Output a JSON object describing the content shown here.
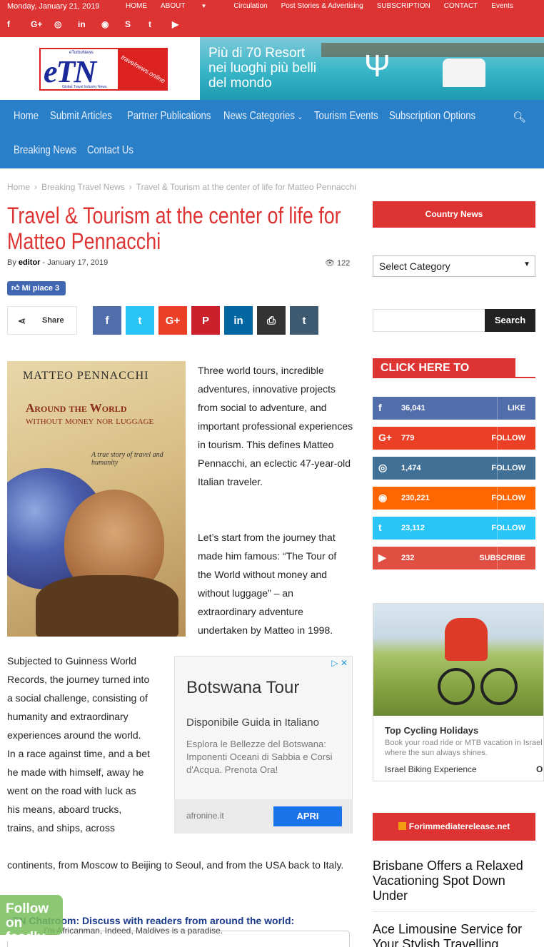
{
  "topbar": {
    "date": "Monday, January 21, 2019",
    "nav": [
      "HOME",
      "ABOUT",
      "Circulation",
      "Post Stories & Advertising",
      "SUBSCRIPTION",
      "CONTACT",
      "Events"
    ],
    "socials": [
      "f",
      "G+",
      "◎",
      "in",
      "◉",
      "S",
      "t",
      "▶"
    ]
  },
  "header": {
    "logo_text": "eTN",
    "logo_top": "eTurboNews",
    "logo_bottom": "Global Travel Industry News",
    "logo_side": "travelnews.online",
    "banner_lines": [
      "Più di 70 Resort",
      "nei luoghi più belli",
      "del mondo"
    ]
  },
  "mainnav": {
    "items": [
      "Home",
      "Submit Articles",
      "Partner Publications",
      "News Categories",
      "Tourism Events",
      "Subscription Options",
      "Breaking News",
      "Contact Us"
    ]
  },
  "breadcrumb": [
    "Home",
    "Breaking Travel News",
    "Travel & Tourism at the center of life for Matteo Pennacchi"
  ],
  "article": {
    "title": "Travel & Tourism at the center of life for Matteo Pennacchi",
    "by": "By",
    "author": "editor",
    "date": "January 17, 2019",
    "views": "122",
    "like": "Mi piace 3",
    "share": "Share",
    "book": {
      "author": "MATTEO PENNACCHI",
      "title1": "Around the World",
      "title2": "without money nor luggage",
      "tagline": "A true story of travel and humanity"
    },
    "p1": "Three world tours, incredible adventures, innovative projects from social to adventure, and important professional experiences in tourism. This defines Matteo Pennacchi, an eclectic 47-year-old Italian traveler.",
    "p2": "Let’s start from the journey that made him famous: “The Tour of the World without money and without luggage” – an extraordinary adventure undertaken by Matteo in 1998.",
    "p3": "Subjected to Guinness World Records, the journey turned into a social challenge, consisting of humanity and extraordinary experiences around the world. In a race against time, and a bet he made with himself, away he went on the road with luck as his means, aboard trucks, trains, and ships, across",
    "p3b": "continents, from Moscow to Beijing to Seoul, and from the USA back to Italy.",
    "chat": "eTN Chatroom: Discuss with readers from around the world:",
    "chat_msg": "I'm Africanman, Indeed, Maldives is a paradise.",
    "follow": "Follow on feedly"
  },
  "ad": {
    "title": "Botswana Tour",
    "subtitle": "Disponibile Guida in Italiano",
    "desc": "Esplora le Bellezze del Botswana: Imponenti Oceani di Sabbia e Corsi d'Acqua. Prenota Ora!",
    "domain": "afronine.it",
    "cta": "APRI"
  },
  "sidebar": {
    "country_news": "Country News",
    "select_category": "Select Category",
    "search": "Search",
    "subscribe": "CLICK HERE TO SUBSCRIBE",
    "socials": [
      {
        "icon": "f",
        "count": "36,041",
        "action": "LIKE",
        "color": "#516eab"
      },
      {
        "icon": "G+",
        "count": "779",
        "action": "FOLLOW",
        "color": "#eb4026"
      },
      {
        "icon": "◎",
        "count": "1,474",
        "action": "FOLLOW",
        "color": "#417096"
      },
      {
        "icon": "◉",
        "count": "230,221",
        "action": "FOLLOW",
        "color": "#ff6600"
      },
      {
        "icon": "t",
        "count": "23,112",
        "action": "FOLLOW",
        "color": "#29c5f6"
      },
      {
        "icon": "▶",
        "count": "232",
        "action": "SUBSCRIBE",
        "color": "#e14e42"
      }
    ],
    "cycle_ad": {
      "title": "Top Cycling Holidays",
      "desc": "Book your road ride or MTB vacation in Israel where the sun always shines.",
      "source": "Israel Biking Experience",
      "cta": "Ol"
    },
    "rss": "Forimmediaterelease.net",
    "news": [
      "Brisbane Offers a Relaxed Vacationing Spot Down Under",
      "Ace Limousine Service for Your Stylish Travelling"
    ]
  },
  "colors": {
    "accent": "#dd3333",
    "nav": "#2a7fc9"
  }
}
